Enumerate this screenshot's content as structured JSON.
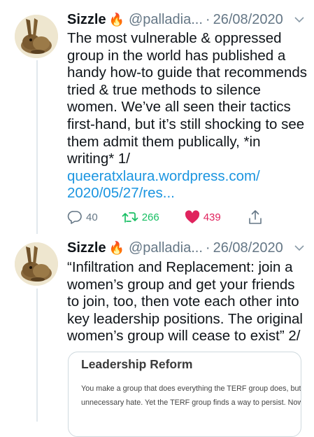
{
  "tweets": [
    {
      "name": "Sizzle",
      "fire": "🔥",
      "handle": "@palladia...",
      "separator": "·",
      "date": "26/08/2020",
      "text": "The most vulnerable & oppressed group in the world has published a handy how-to guide that recommends tried & true methods to silence women. We’ve all seen their tactics first-hand, but it’s still shocking to see them admit them publically, *in writing* 1/",
      "link_line1": "queeratxlaura.wordpress.com/",
      "link_line2": "2020/05/27/res...",
      "replies": "40",
      "retweets": "266",
      "likes": "439"
    },
    {
      "name": "Sizzle",
      "fire": "🔥",
      "handle": "@palladia...",
      "separator": "·",
      "date": "26/08/2020",
      "text": "“Infiltration and Replacement: join a women’s group and get your friends to join, too, then vote each other into key leadership positions. The original women’s group will cease to exist” 2/"
    }
  ],
  "card": {
    "title": "Leadership Reform",
    "line1": "You make a group that does everything the TERF group does, but wit",
    "line2": "unnecessary hate. Yet the TERF group finds a way to persist. Now wh"
  },
  "icons": {
    "avatar": "hare-avatar",
    "menu": "chevron-down-icon",
    "reply": "reply-icon",
    "retweet": "retweet-icon",
    "like": "heart-icon",
    "share": "share-icon"
  },
  "colors": {
    "text": "#0f1419",
    "secondary": "#657786",
    "link": "#1b95e0",
    "retweet": "#17bf63",
    "like": "#e0245e"
  }
}
